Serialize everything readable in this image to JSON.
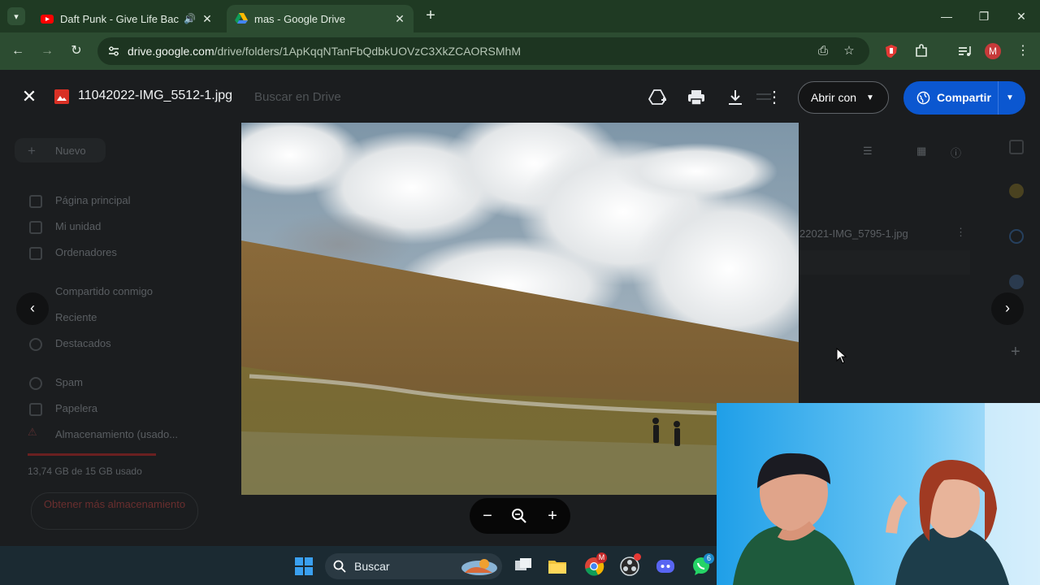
{
  "browser": {
    "tabs": [
      {
        "title": "Daft Punk - Give Life Back to Music",
        "active": false,
        "playing_audio": true
      },
      {
        "title": "mas - Google Drive",
        "active": true,
        "playing_audio": false
      }
    ],
    "url_host": "drive.google.com",
    "url_path": "/drive/folders/1ApKqqNTanFbQdbkUOVzC3XkZCAORSMhM",
    "profile_initial": "M"
  },
  "drive_background": {
    "search_placeholder": "Buscar en Drive",
    "new_button": "Nuevo",
    "nav": [
      "Página principal",
      "Mi unidad",
      "Ordenadores",
      "Compartido conmigo",
      "Reciente",
      "Destacados",
      "Spam",
      "Papelera",
      "Almacenamiento (usado..."
    ],
    "storage_text": "13,74 GB de 15 GB usado",
    "get_more_storage": "Obtener más almacenamiento",
    "right_file_name": "22021-IMG_5795-1.jpg"
  },
  "viewer": {
    "file_name": "11042022-IMG_5512-1.jpg",
    "open_with_label": "Abrir con",
    "share_label": "Compartir"
  },
  "taskbar": {
    "search_label": "Buscar",
    "chrome_badge": "M",
    "whatsapp_badge": "6"
  },
  "colors": {
    "accent_share": "#0b57d0",
    "browser_frame": "#1f3a23",
    "taskbar": "#1b2a32"
  }
}
